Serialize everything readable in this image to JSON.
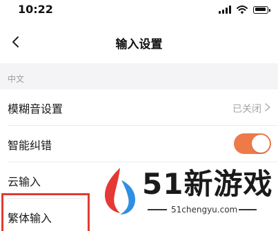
{
  "status_bar": {
    "time": "10:22"
  },
  "nav": {
    "title": "输入设置",
    "back_icon": "chevron-left-icon"
  },
  "section": {
    "label": "中文"
  },
  "rows": [
    {
      "label": "模糊音设置",
      "value": "已关闭",
      "control": "chevron-right-icon"
    },
    {
      "label": "智能纠错",
      "control": "toggle",
      "toggle_on": true
    },
    {
      "label": "云输入"
    },
    {
      "label": "繁体输入"
    }
  ],
  "watermark": {
    "brand": "51新游戏",
    "url": "51chengyu.com",
    "colors": {
      "red": "#e53935",
      "blue": "#2f8fe0"
    }
  },
  "colors": {
    "accent": "#ee7a4a",
    "highlight": "#e23b30"
  }
}
